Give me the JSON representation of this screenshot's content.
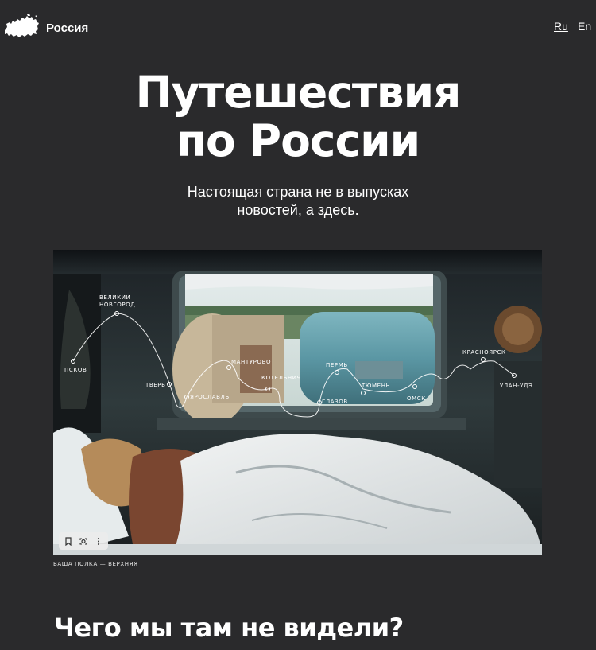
{
  "header": {
    "logo_text": "Россия",
    "lang_ru": "Ru",
    "lang_en": "En"
  },
  "hero": {
    "title_line1": "Путешествия",
    "title_line2": "по России",
    "subtitle_line1": "Настоящая страна не в выпусках",
    "subtitle_line2": "новостей, а здесь."
  },
  "route": {
    "cities": [
      "ПСКОВ",
      "ВЕЛИКИЙ",
      "НОВГОРОД",
      "ТВЕРЬ",
      "ЯРОСЛАВЛЬ",
      "МАНТУРОВО",
      "КОТЕЛЬНИЧ",
      "ГЛАЗОВ",
      "ПЕРМЬ",
      "ТЮМЕНЬ",
      "ОМСК",
      "КРАСНОЯРСК",
      "УЛАН-УДЭ"
    ]
  },
  "photo": {
    "caption": "ВАША ПОЛКА — ВЕРХНЯЯ"
  },
  "section": {
    "title": "Чего мы там не видели?"
  },
  "colors": {
    "background": "#2a2a2c",
    "text": "#ffffff"
  }
}
